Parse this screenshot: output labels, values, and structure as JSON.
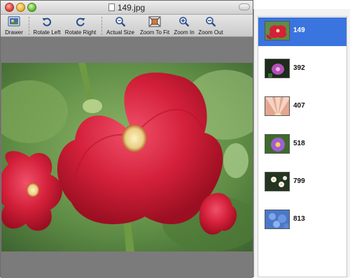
{
  "window": {
    "title": "149.jpg"
  },
  "toolbar": {
    "drawer": "Drawer",
    "rotate_left": "Rotate Left",
    "rotate_right": "Rotate Right",
    "actual_size": "Actual Size",
    "zoom_to_fit": "Zoom To Fit",
    "zoom_in": "Zoom In",
    "zoom_out": "Zoom Out"
  },
  "drawer": {
    "items": [
      {
        "label": "149",
        "selected": true,
        "thumb": "red-flower"
      },
      {
        "label": "392",
        "selected": false,
        "thumb": "purple-flower-dark"
      },
      {
        "label": "407",
        "selected": false,
        "thumb": "pink-flower-closeup"
      },
      {
        "label": "518",
        "selected": false,
        "thumb": "purple-daisy"
      },
      {
        "label": "799",
        "selected": false,
        "thumb": "white-flowers"
      },
      {
        "label": "813",
        "selected": false,
        "thumb": "blue-hydrangea"
      }
    ]
  },
  "colors": {
    "selection": "#3a74de",
    "canvas": "#7b7b7b"
  }
}
